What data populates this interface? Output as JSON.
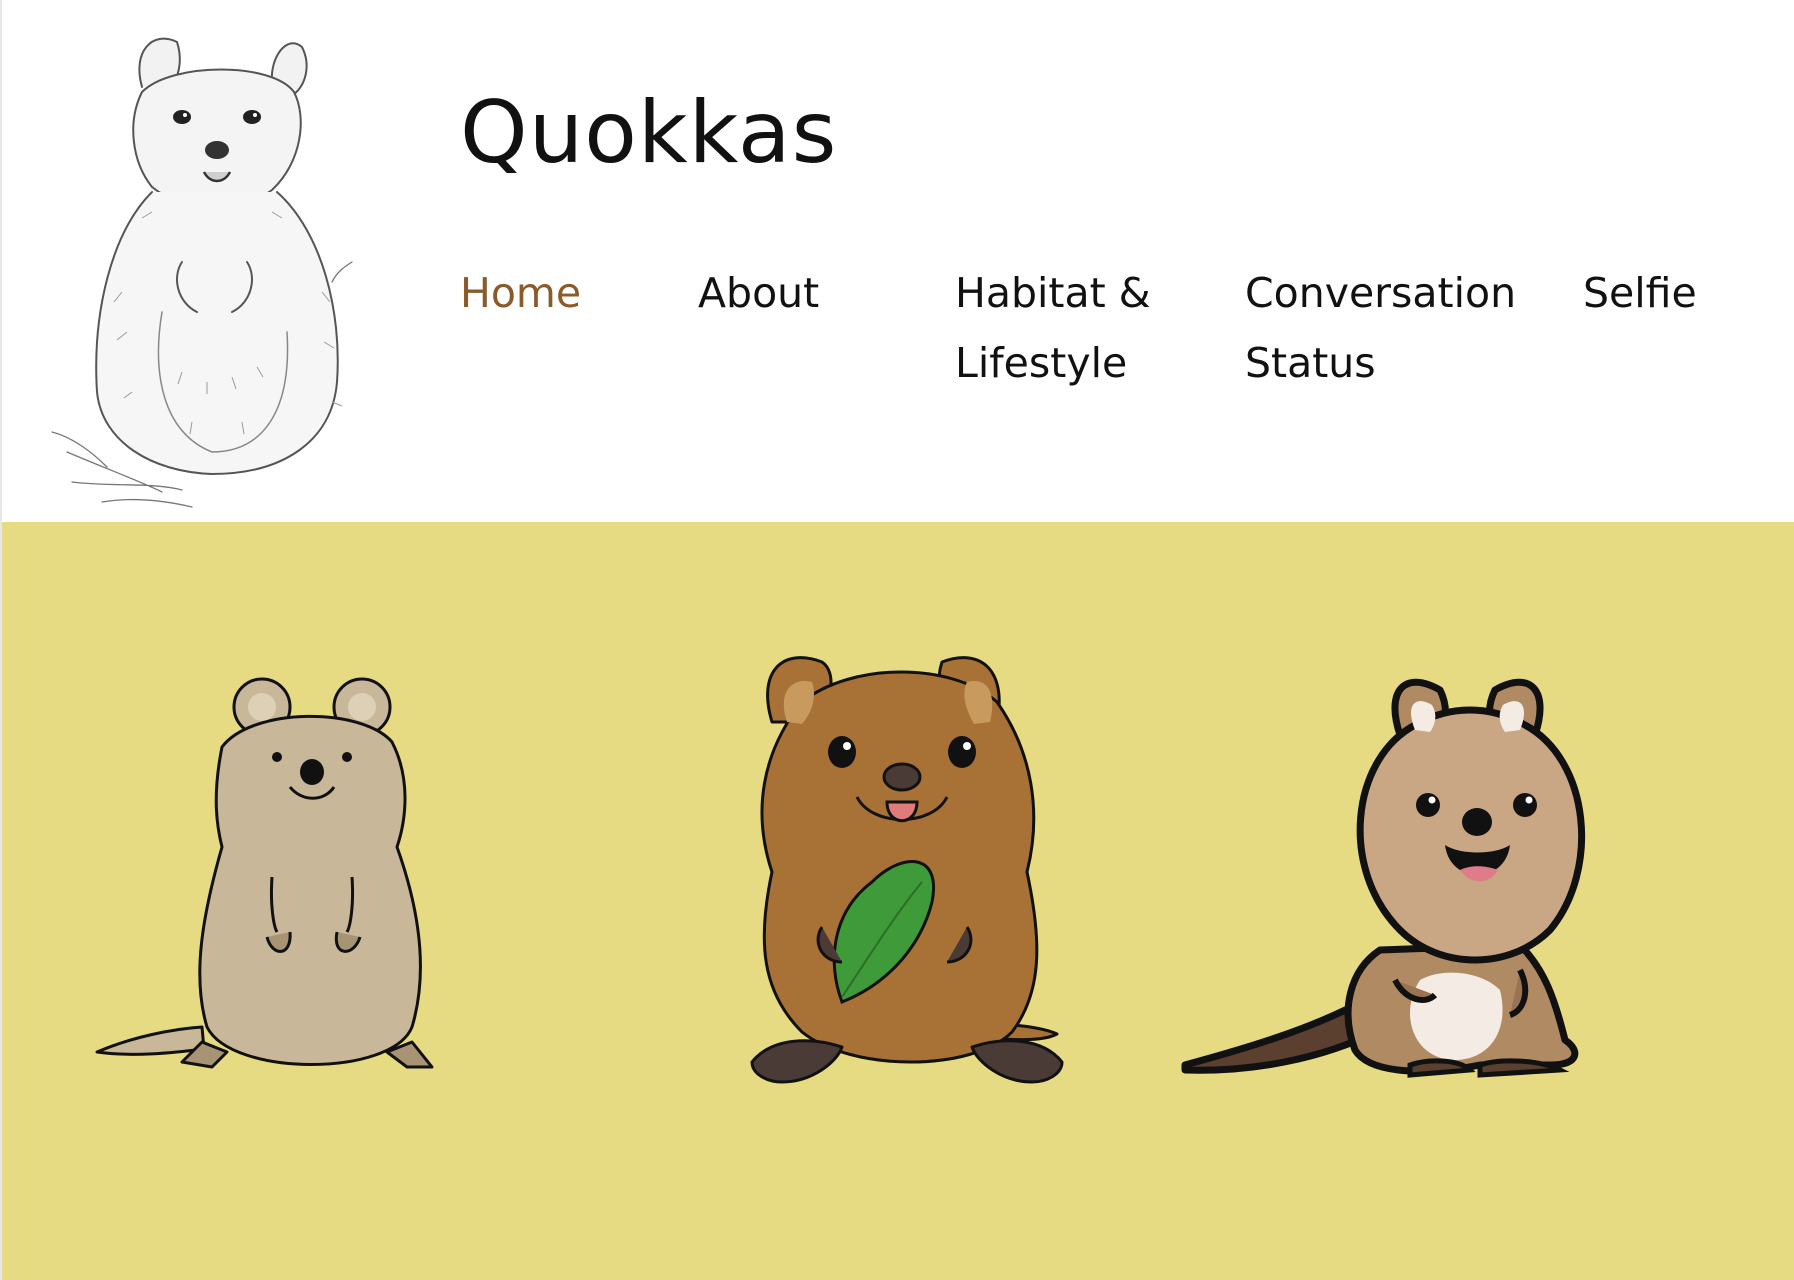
{
  "site": {
    "title": "Quokkas"
  },
  "nav": {
    "items": [
      {
        "id": "home",
        "label": "Home",
        "active": true
      },
      {
        "id": "about",
        "label": "About",
        "active": false
      },
      {
        "id": "habitat",
        "label": "Habitat & Lifestyle",
        "active": false
      },
      {
        "id": "conservation",
        "label": "Conversation Status",
        "active": false
      },
      {
        "id": "selfie",
        "label": "Selfie",
        "active": false
      }
    ]
  },
  "colors": {
    "accent": "#8a5a2b",
    "banner_background": "#e6da82",
    "text": "#111111"
  },
  "icons": [
    "quokka-sketch-logo",
    "quokka-cartoon-beige",
    "quokka-cartoon-leaf",
    "quokka-cartoon-happy"
  ]
}
